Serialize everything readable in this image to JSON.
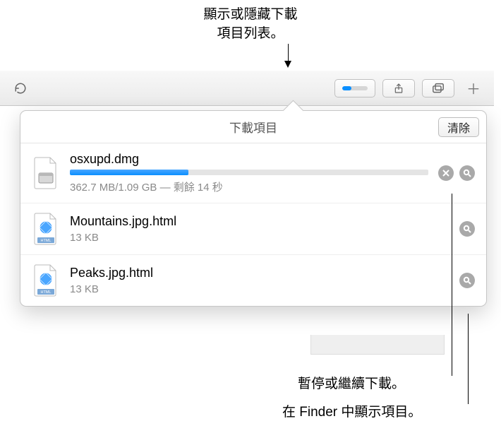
{
  "annotations": {
    "top_line1": "顯示或隱藏下載",
    "top_line2": "項目列表。",
    "bottom1": "暫停或繼續下載。",
    "bottom2": "在 Finder 中顯示項目。"
  },
  "toolbar": {
    "reload_name": "reload-icon",
    "download_progress": 35,
    "share_name": "share-icon",
    "tabs_name": "tabs-icon",
    "newtab_name": "new-tab-icon"
  },
  "popover": {
    "title": "下載項目",
    "clear_label": "清除"
  },
  "downloads": [
    {
      "name": "osxupd.dmg",
      "meta": "362.7 MB/1.09 GB — 剩餘 14 秒",
      "progress": 33,
      "icon": "dmg",
      "stoppable": true
    },
    {
      "name": "Mountains.jpg.html",
      "meta": "13 KB",
      "progress": null,
      "icon": "html",
      "stoppable": false
    },
    {
      "name": "Peaks.jpg.html",
      "meta": "13 KB",
      "progress": null,
      "icon": "html",
      "stoppable": false
    }
  ]
}
